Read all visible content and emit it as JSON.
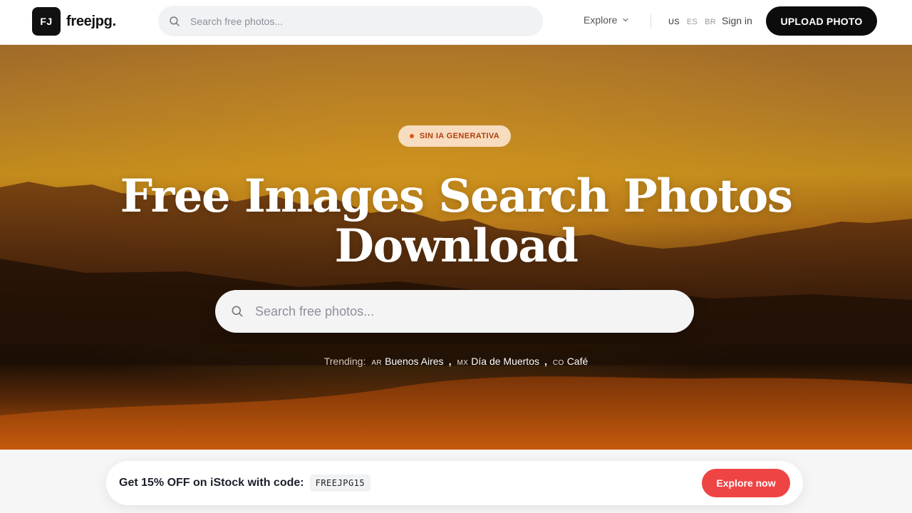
{
  "brand": {
    "mark": "FJ",
    "name": "freejpg."
  },
  "header": {
    "search_placeholder": "Search free photos...",
    "explore_label": "Explore",
    "languages": [
      {
        "code": "US",
        "active": true
      },
      {
        "code": "ES",
        "active": false
      },
      {
        "code": "BR",
        "active": false
      }
    ],
    "signin_label": "Sign in",
    "upload_label": "UPLOAD PHOTO"
  },
  "hero": {
    "badge": "SIN IA GENERATIVA",
    "title_line1": "Free Images Search Photos",
    "title_line2": "Download",
    "search_placeholder": "Search free photos...",
    "trending_label": "Trending:",
    "trending": [
      {
        "country": "AR",
        "label": "Buenos Aires"
      },
      {
        "country": "MX",
        "label": "Día de Muertos"
      },
      {
        "country": "CO",
        "label": "Café"
      }
    ],
    "trending_separator": ","
  },
  "promo": {
    "text": "Get 15% OFF on iStock with code:",
    "code": "FREEJPG15",
    "button_label": "Explore now"
  },
  "colors": {
    "accent_red": "#ef4444",
    "badge_bg": "#f7dcbf",
    "badge_text": "#b23e0c",
    "dark": "#0c0c0c"
  },
  "icons": {
    "search": "search-icon",
    "explore_chevron": "chevron-down-icon",
    "badge_dot": "dot-icon"
  }
}
